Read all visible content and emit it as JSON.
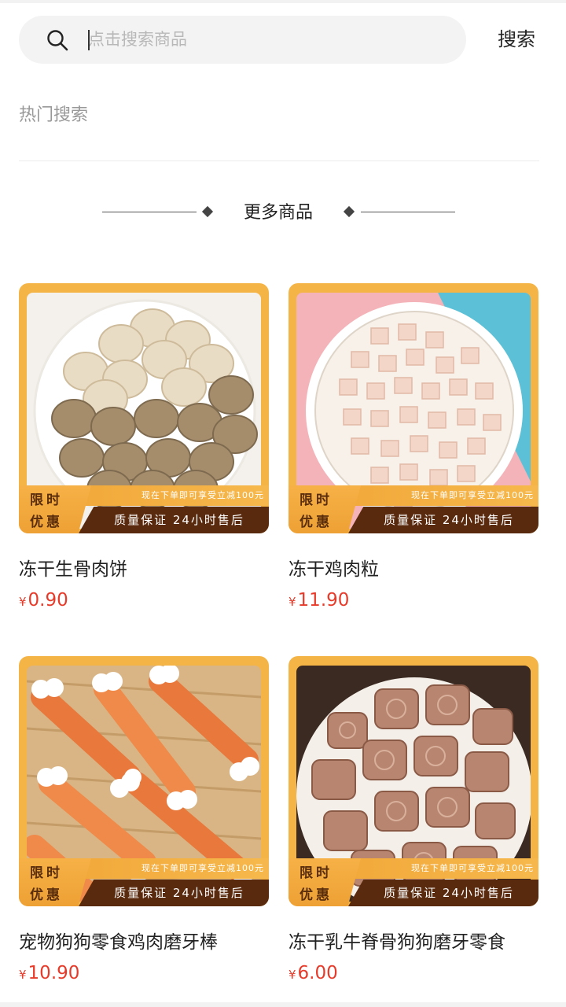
{
  "search": {
    "placeholder": "点击搜索商品",
    "button_label": "搜索"
  },
  "hot_search": {
    "title": "热门搜索"
  },
  "more": {
    "title": "更多商品"
  },
  "promo": {
    "badge_line1": "限时",
    "badge_line2": "优惠",
    "top_text": "现在下单即可享受立减100元",
    "bottom_text": "质量保证 24小时售后"
  },
  "colors": {
    "price": "#e63b2a",
    "frame": "#f4b446",
    "promo_dark": "#5a2a0e"
  },
  "products": [
    {
      "name": "冻干生骨肉饼",
      "currency": "¥",
      "price": "0.90"
    },
    {
      "name": "冻干鸡肉粒",
      "currency": "¥",
      "price": "11.90"
    },
    {
      "name": "宠物狗狗零食鸡肉磨牙棒",
      "currency": "¥",
      "price": "10.90"
    },
    {
      "name": "冻干乳牛脊骨狗狗磨牙零食",
      "currency": "¥",
      "price": "6.00"
    }
  ]
}
